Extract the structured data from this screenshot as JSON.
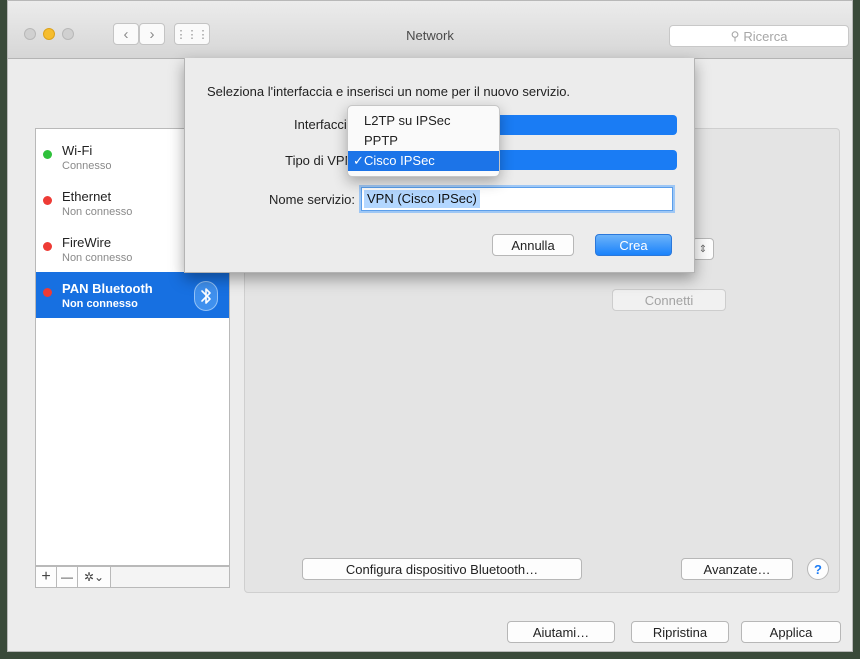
{
  "window": {
    "title": "Network",
    "search_placeholder": "Ricerca",
    "grid_icon_glyph": "⋮⋮⋮"
  },
  "sidebar": {
    "items": [
      {
        "name": "Wi-Fi",
        "status": "Connesso",
        "dot": "#2fc13b",
        "selected": false
      },
      {
        "name": "Ethernet",
        "status": "Non connesso",
        "dot": "#ee3b35",
        "selected": false
      },
      {
        "name": "FireWire",
        "status": "Non connesso",
        "dot": "#ee3b35",
        "selected": false
      },
      {
        "name": "PAN Bluetooth",
        "status": "Non connesso",
        "dot": "#ee3b35",
        "selected": true
      }
    ],
    "add": "+",
    "remove": "—",
    "gear": "✲⌄"
  },
  "content": {
    "connect_button": "Connetti",
    "configure_button": "Configura dispositivo Bluetooth…",
    "advanced_button": "Avanzate…",
    "help": "?"
  },
  "sheet": {
    "instruction": "Seleziona l'interfaccia e inserisci un nome per il nuovo servizio.",
    "interface_label": "Interfaccia",
    "vpn_type_label": "Tipo di VPN",
    "service_name_label": "Nome servizio:",
    "service_name_value": "VPN (Cisco IPSec)",
    "cancel_button": "Annulla",
    "create_button": "Crea"
  },
  "vpn_menu": {
    "options": [
      "L2TP su IPSec",
      "PPTP",
      "Cisco IPSec"
    ],
    "selected": "Cisco IPSec",
    "check": "✓"
  },
  "footer": {
    "help_button": "Aiutami…",
    "revert_button": "Ripristina",
    "apply_button": "Applica"
  },
  "colors": {
    "accent": "#1770e1",
    "connected": "#2fc13b",
    "disconnected": "#ee3b35"
  }
}
